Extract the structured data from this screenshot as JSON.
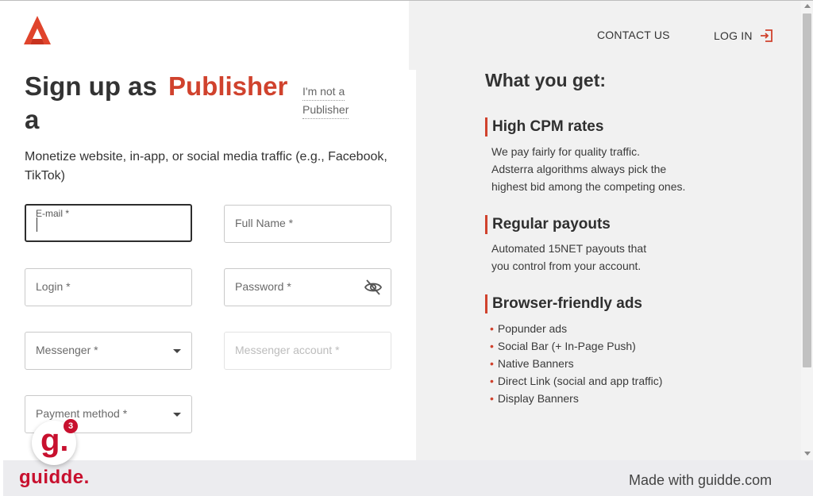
{
  "header": {
    "contact_label": "CONTACT US",
    "login_label": "LOG IN"
  },
  "signup": {
    "title_prefix": "Sign up as",
    "title_a": "a",
    "title_role": "Publisher",
    "not_role_line1": "I'm not a",
    "not_role_line2": "Publisher",
    "subtitle": "Monetize website, in-app, or social media traffic (e.g., Facebook, TikTok)"
  },
  "form": {
    "email_label": "E-mail *",
    "fullname_label": "Full Name *",
    "login_label": "Login *",
    "password_label": "Password *",
    "messenger_label": "Messenger *",
    "messenger_account_label": "Messenger account *",
    "payment_label": "Payment method *"
  },
  "benefits": {
    "title": "What you get:",
    "features": [
      {
        "heading": "High CPM rates",
        "lines": [
          "We pay fairly for quality traffic.",
          "Adsterra algorithms always pick the",
          "highest bid among the competing ones."
        ]
      },
      {
        "heading": "Regular payouts",
        "lines": [
          "Automated 15NET payouts that",
          "you control from your account."
        ]
      },
      {
        "heading": "Browser-friendly ads",
        "bullets": [
          "Popunder ads",
          "Social Bar (+ In-Page Push)",
          "Native Banners",
          "Direct Link (social and app traffic)",
          "Display Banners"
        ]
      }
    ]
  },
  "footer": {
    "brand": "guidde.",
    "made_with": "Made with guidde.com"
  },
  "badge": {
    "letter": "g.",
    "count": "3"
  },
  "colors": {
    "accent": "#d0422d",
    "guidde_red": "#c8102e",
    "panel_bg": "#f1f1f1"
  },
  "icons": [
    "adsterra-logo-icon",
    "log-in-icon",
    "eye-off-icon",
    "chevron-down-icon"
  ]
}
